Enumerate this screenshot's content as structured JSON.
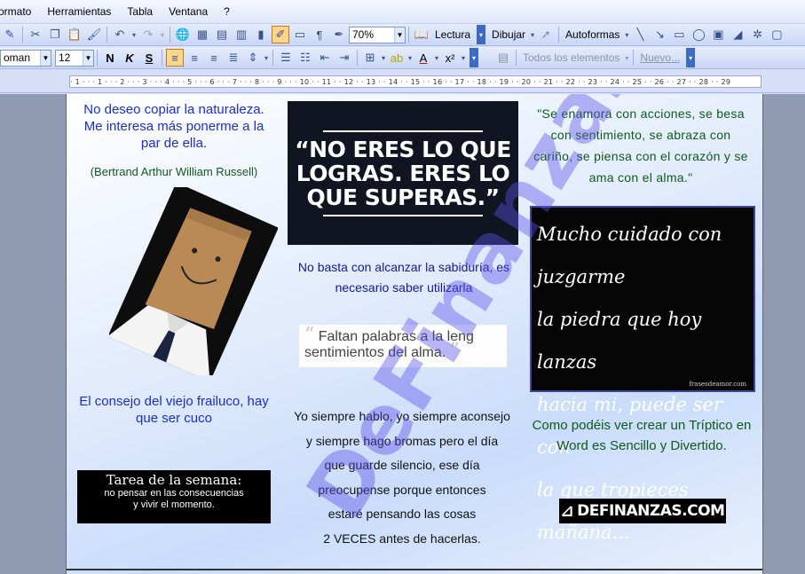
{
  "menu": {
    "items": [
      "ormato",
      "Herramientas",
      "Tabla",
      "Ventana",
      "?"
    ]
  },
  "toolbar1": {
    "zoom": "70%",
    "read_label": "Lectura",
    "draw_label": "Dibujar",
    "autoshapes_label": "Autoformas"
  },
  "toolbar2": {
    "font_name": "oman",
    "font_size": "12",
    "bold": "N",
    "italic": "K",
    "underline": "S",
    "styles_label": "Todos los elementos",
    "new_label": "Nuevo..."
  },
  "ruler": {
    "marks": "· 1 · · · 1 · · · 2 · · · 3 · · · 4 · · · 5 · · · 6 · · · 7 · · · 8 · · · 9 · · · 10 · · 11 · · 12 · · 13 · · 14 · · 15 · · 16 · · 17 · · 18 · · 19 · · 20 · · 21 · · 22 · · 23 · · 24 · · 25 · · 26 · · 27 · · 28 · · 29"
  },
  "document": {
    "col1": {
      "quote": "No deseo copiar la naturaleza. Me interesa más ponerme a la par de ella.",
      "author": "(Bertrand Arthur William Russell)",
      "consejo": "El consejo del viejo frailuco, hay que ser cuco",
      "tarea_title": "Tarea de la semana:",
      "tarea_line1": "no pensar en las consecuencias",
      "tarea_line2": "y vivir el momento."
    },
    "col2": {
      "image_quote": "“NO ERES LO QUE LOGRAS. ERES LO QUE SUPERAS.”",
      "sabiduria": "No basta con alcanzar la sabiduría, es necesario saber utilizarla",
      "faltan_line1": "Faltan palabras a la leng",
      "faltan_line2": "sentimientos del alma.",
      "hablo_lines": [
        "Yo siempre hablo, yo siempre aconsejo",
        "y siempre hago bromas pero el día",
        "que guarde silencio, ese día",
        "preocupense porque entonces",
        "estaré pensando las cosas",
        "2 VECES antes de hacerlas."
      ]
    },
    "col3": {
      "enamora": "\"Se enamora con acciones, se besa con sentimiento, se abraza con cariño, se piensa con el corazón y se ama con el alma.\"",
      "board_lines": [
        "Mucho cuidado con juzgarme",
        "la piedra que hoy lanzas",
        "hacia mi, puede ser con",
        "la que tropieces mañana..."
      ],
      "board_credit": "frasesdeamor.com",
      "triptico": "Como podéis ver crear un Tríptico en Word es Sencillo y Divertido.",
      "logo_text": "DEFINANZAS.COM"
    },
    "watermark": "DeFinanzas"
  }
}
